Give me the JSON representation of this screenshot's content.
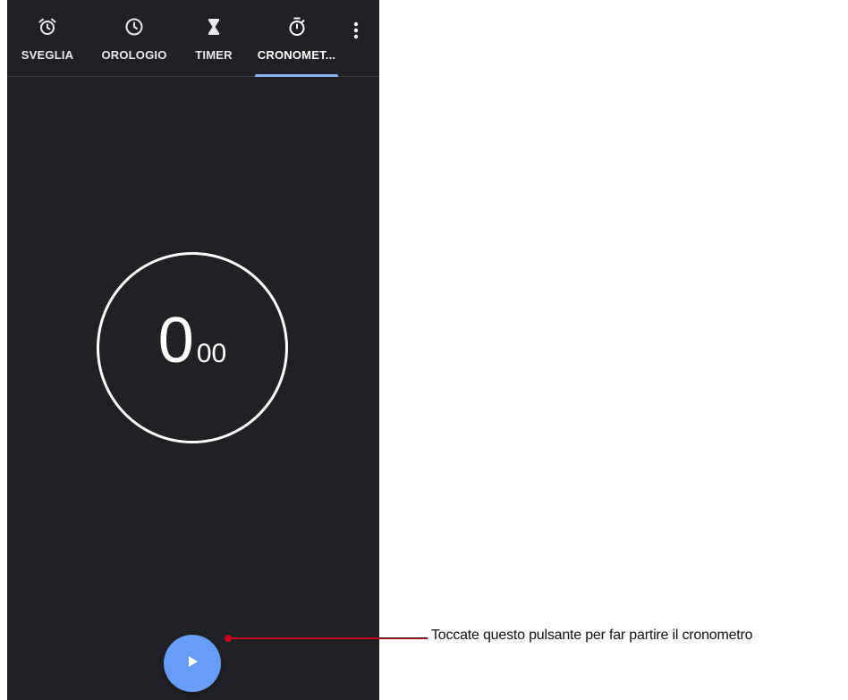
{
  "tabs": [
    {
      "label": "SVEGLIA",
      "icon": "alarm-clock-icon",
      "active": false
    },
    {
      "label": "OROLOGIO",
      "icon": "clock-icon",
      "active": false
    },
    {
      "label": "TIMER",
      "icon": "hourglass-icon",
      "active": false
    },
    {
      "label": "CRONOMET...",
      "icon": "stopwatch-icon",
      "active": true
    }
  ],
  "overflow_menu_icon": "more-vert-icon",
  "stopwatch": {
    "seconds": "0",
    "hundredths": "00"
  },
  "start_button_icon": "play-icon",
  "callout": {
    "text": "Toccate questo pulsante per far partire il cronometro"
  },
  "colors": {
    "background": "#202124",
    "accent": "#8ab4f8",
    "fab": "#669df6",
    "callout": "#d0021b"
  }
}
